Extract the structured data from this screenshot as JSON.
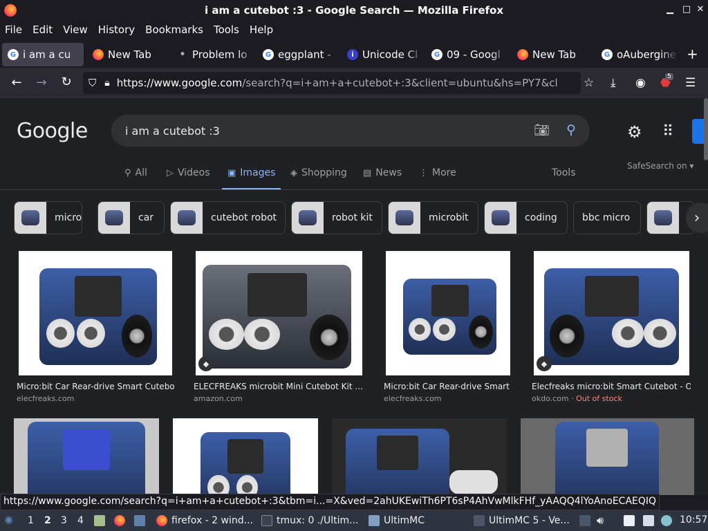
{
  "window": {
    "title": "i am a cutebot :3 - Google Search — Mozilla Firefox"
  },
  "menu": [
    "File",
    "Edit",
    "View",
    "History",
    "Bookmarks",
    "Tools",
    "Help"
  ],
  "tabs": [
    {
      "label": "i am a cu",
      "icon": "google-icon"
    },
    {
      "label": "New Tab",
      "icon": "firefox-icon"
    },
    {
      "label": "Problem lo",
      "icon": "dot-icon"
    },
    {
      "label": "eggplant -",
      "icon": "google-icon"
    },
    {
      "label": "Unicode Cl",
      "icon": "info-icon"
    },
    {
      "label": "09 - Googl",
      "icon": "google-icon"
    },
    {
      "label": "New Tab",
      "icon": "firefox-icon"
    },
    {
      "label": "oAubergine",
      "icon": "google-icon"
    }
  ],
  "url": {
    "host": "https://www.google.com",
    "rest": "/search?q=i+am+a+cutebot+:3&client=ubuntu&hs=PY7&cl"
  },
  "extension_badge": "5",
  "google": {
    "logo": "Google",
    "query": "i am a cutebot :3",
    "tabs": [
      "All",
      "Videos",
      "Images",
      "Shopping",
      "News",
      "More"
    ],
    "tools": "Tools",
    "safesearch": "SafeSearch on"
  },
  "chips": [
    "micro",
    "car",
    "cutebot robot",
    "robot kit",
    "microbit",
    "coding",
    "bbc micro"
  ],
  "results": [
    {
      "caption": "Micro:bit Car Rear-drive Smart Cutebot ...",
      "source": "elecfreaks.com",
      "extra": ""
    },
    {
      "caption": "ELECFREAKS microbit Mini Cutebot Kit ...",
      "source": "amazon.com",
      "extra": ""
    },
    {
      "caption": "Micro:bit Car Rear-drive Smart C...",
      "source": "elecfreaks.com",
      "extra": ""
    },
    {
      "caption": "Elecfreaks micro:bit Smart Cutebot - OK...",
      "source": "okdo.com",
      "extra": "Out of stock"
    }
  ],
  "status_url": "https://www.google.com/search?q=i+am+a+cutebot+:3&tbm=i...=X&ved=2ahUKEwiTh6PT6sP4AhVwMlkFHf_yAAQQ4lYoAnoECAEQIQ",
  "taskbar": {
    "workspaces": [
      "1",
      "2",
      "3",
      "4"
    ],
    "items": [
      "firefox - 2 wind...",
      "tmux: 0 ./Ultim...",
      "UltimMC",
      "UltimMC 5 - Ve..."
    ],
    "clock": "10:57"
  },
  "colors": {
    "accent": "#8ab4f8",
    "bg": "#202124",
    "chrome": "#1c1b22"
  }
}
